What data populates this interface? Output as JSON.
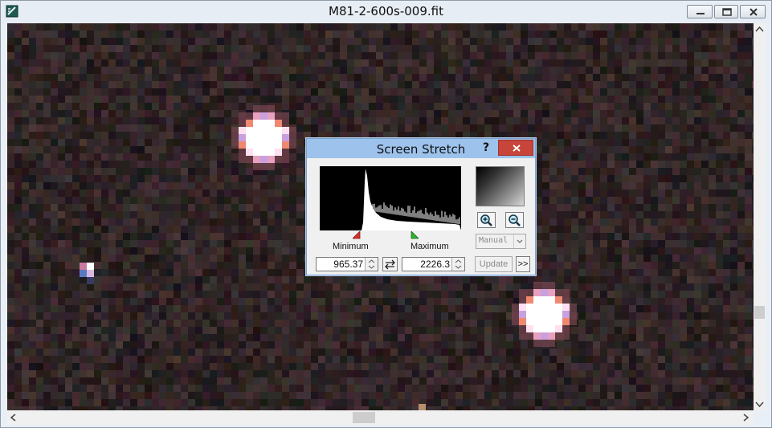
{
  "window": {
    "title": "M81-2-600s-009.fit",
    "icon": "fits-image-icon",
    "controls": [
      "minimize-icon",
      "maximize-icon",
      "close-icon"
    ]
  },
  "dialog": {
    "title": "Screen Stretch",
    "help_label": "?",
    "minimum_label": "Minimum",
    "maximum_label": "Maximum",
    "minimum_value": "965.37",
    "maximum_value": "2226.3",
    "mode_value": "Manual",
    "update_label": "Update",
    "more_label": ">>",
    "icons": [
      "zoom-in-icon",
      "zoom-out-icon",
      "swap-icon",
      "close-icon"
    ],
    "colors": {
      "titlebar": "#9dc3ec",
      "close": "#c7453b",
      "min_marker": "#d9302a",
      "max_marker": "#2fb22f"
    }
  }
}
